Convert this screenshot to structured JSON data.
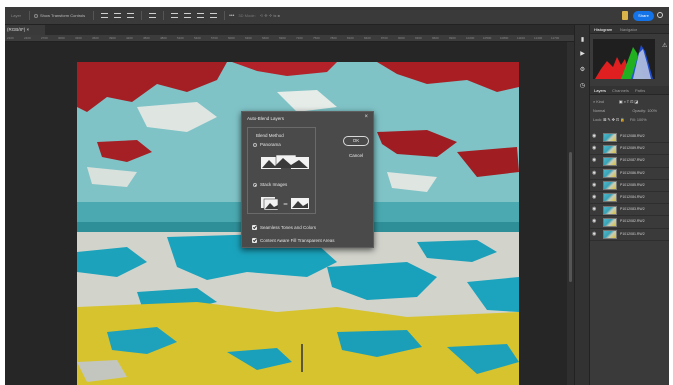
{
  "options_bar": {
    "auto_select_label": "Layer",
    "show_transform_controls": "Show Transform Controls",
    "mode_3d_label": "3D Mode:",
    "more": "•••",
    "share_label": "Share"
  },
  "document": {
    "tab_label": "(RGB/8*) ×",
    "ruler_ticks": [
      "2100",
      "2400",
      "2700",
      "3000",
      "3300",
      "3600",
      "3900",
      "4200",
      "4500",
      "4800",
      "5100",
      "5400",
      "5700",
      "6000",
      "6300",
      "6600",
      "6900",
      "7200",
      "7500",
      "7800",
      "8100",
      "8400",
      "8700",
      "9000",
      "9300",
      "9600",
      "9900",
      "10200",
      "10500",
      "10800",
      "11100",
      "11400",
      "11700"
    ]
  },
  "dialog": {
    "title": "Auto-Blend Layers",
    "close": "×",
    "blend_method_label": "Blend Method",
    "panorama_label": "Panorama",
    "stack_images_label": "Stack Images",
    "ok_label": "OK",
    "cancel_label": "Cancel",
    "seamless_label": "Seamless Tones and Colors",
    "content_aware_label": "Content Aware Fill Transparent Areas",
    "selected_method": "Stack Images"
  },
  "panels": {
    "histogram_tab": "Histogram",
    "navigator_tab": "Navigator",
    "layers_tab": "Layers",
    "channels_tab": "Channels",
    "paths_tab": "Paths",
    "kind_label": "Kind",
    "blend_mode": "Normal",
    "opacity_label": "Opacity:",
    "opacity_value": "100%",
    "lock_label": "Lock:",
    "fill_label": "Fill:",
    "fill_value": "100%",
    "layers": [
      {
        "name": "P1012088.RW2"
      },
      {
        "name": "P1012089.RW2"
      },
      {
        "name": "P1012087.RW2"
      },
      {
        "name": "P1012086.RW2"
      },
      {
        "name": "P1012085.RW2"
      },
      {
        "name": "P1012084.RW2"
      },
      {
        "name": "P1012083.RW2"
      },
      {
        "name": "P1012082.RW2"
      },
      {
        "name": "P1012081.RW2"
      }
    ]
  }
}
